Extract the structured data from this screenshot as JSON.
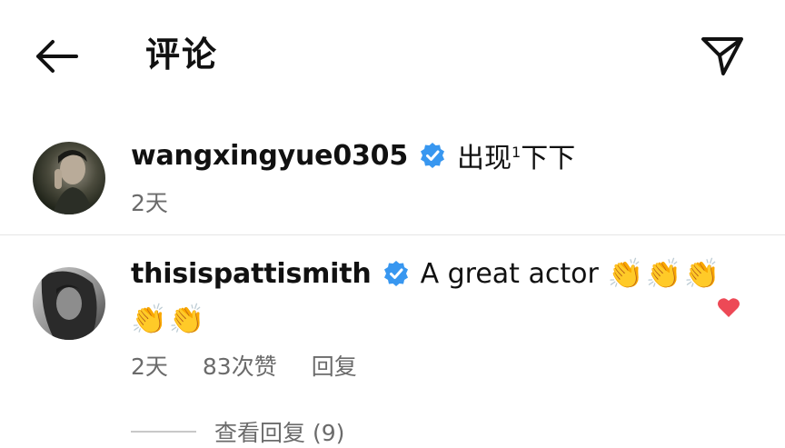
{
  "header": {
    "title": "评论",
    "back_icon": "arrow-left-icon",
    "send_icon": "paper-plane-icon"
  },
  "comments": [
    {
      "username": "wangxingyue0305",
      "verified": true,
      "text_main": "出现",
      "text_sup": "1",
      "text_after": "下下",
      "time": "2天"
    },
    {
      "username": "thisispattismith",
      "verified": true,
      "text_main": "A great actor",
      "emoji": "👏",
      "time": "2天",
      "likes": "83次赞",
      "reply_label": "回复",
      "liked": true
    }
  ],
  "view_replies": "查看回复 (9)",
  "colors": {
    "verified_blue": "#3897f0",
    "like_red": "#ed4956",
    "meta_gray": "#6b6b6b"
  }
}
